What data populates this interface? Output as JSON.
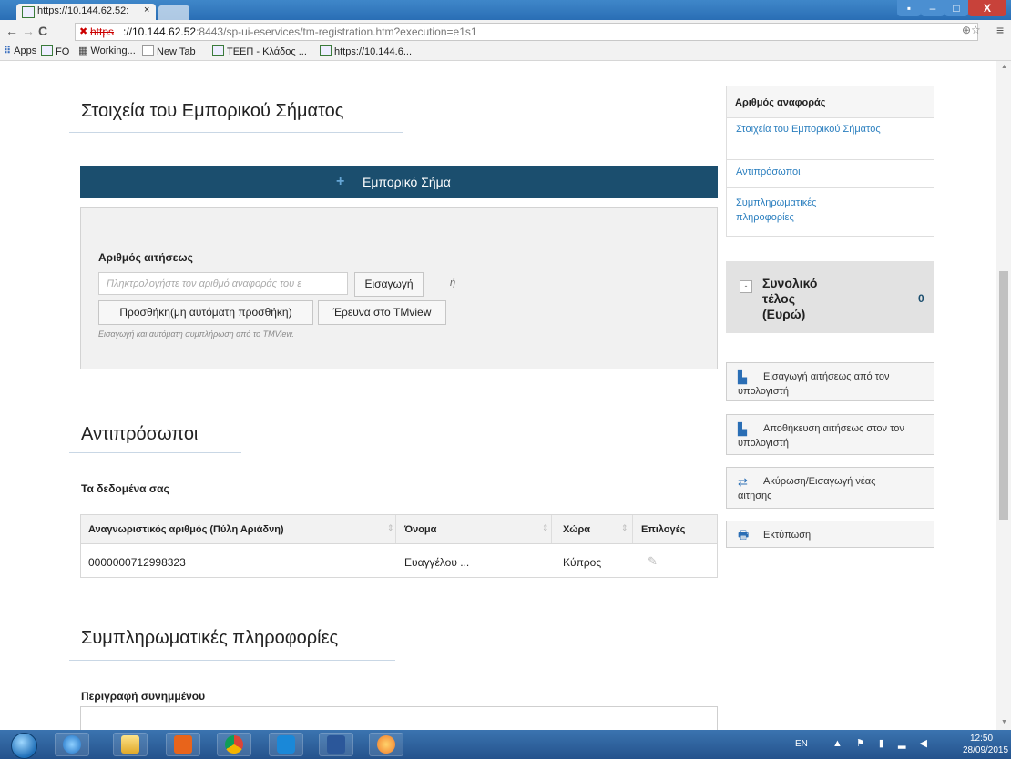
{
  "browser": {
    "tab_title": "https://10.144.62.52:",
    "tab_close": "×",
    "url_scheme": "https",
    "url_host": "://10.144.62.52",
    "url_rest": ":8443/sp-ui-eservices/tm-registration.htm?execution=e1s1",
    "nav": {
      "back": "←",
      "forward": "→",
      "reload": "C"
    },
    "zoom_star": "⊕☆",
    "menu": "≡",
    "window_buttons": {
      "min": "▪",
      "minimize": "–",
      "maximize": "□",
      "close": "X"
    }
  },
  "bookmarks": [
    {
      "label": "Apps",
      "icon": "apps-grid-icon"
    },
    {
      "label": "FO",
      "icon": "page-icon"
    },
    {
      "label": "Working...",
      "icon": "grid-icon"
    },
    {
      "label": "New Tab",
      "icon": "page-icon"
    },
    {
      "label": "ΤΕΕΠ - Κλάδος ...",
      "icon": "page-icon"
    },
    {
      "label": "https://10.144.6...",
      "icon": "page-icon"
    }
  ],
  "trademark_section": {
    "title": "Στοιχεία του Εμπορικού Σήματος",
    "bar_label": "Εμπορικό Σήμα",
    "bar_plus": "+",
    "application_number_label": "Αριθμός αιτήσεως",
    "application_number_placeholder": "Πληκτρολογήστε τον αριθμό αναφοράς του ε",
    "insert_button": "Εισαγωγή",
    "or_text": "ή",
    "add_button": "Προσθήκη(μη αυτόματη προσθήκη)",
    "tmview_button": "Έρευνα στο TMview",
    "hint": "Εισαγωγή και αυτόματη συμπλήρωση από το TMView."
  },
  "representatives_section": {
    "title": "Αντιπρόσωποι",
    "subtitle": "Τα δεδομένα σας",
    "columns": [
      "Αναγνωριστικός αριθμός (Πύλη Αριάδνη)",
      "Όνομα",
      "Χώρα",
      "Επιλογές"
    ],
    "rows": [
      {
        "id": "0000000712998323",
        "name": "Ευαγγέλου ...",
        "country": "Κύπρος"
      }
    ]
  },
  "supplementary_section": {
    "title": "Συμπληρωματικές πληροφορίες",
    "attachment_label": "Περιγραφή συνημμένου"
  },
  "sidebar": {
    "nav_header": "Αριθμός αναφοράς",
    "nav_items": [
      "Στοιχεία του Εμπορικού Σήματος",
      "Αντιπρόσωποι",
      "Συμπληρωματικές πληροφορίες"
    ],
    "fee_label": "Συνολικό τέλος (Ευρώ)",
    "fee_toggle": "-",
    "fee_value": "0",
    "actions": [
      {
        "label": "Εισαγωγή αιτήσεως από τον υπολογιστή",
        "icon": "file-import-icon"
      },
      {
        "label": "Αποθήκευση αιτήσεως στον τον υπολογιστή",
        "icon": "file-save-icon"
      },
      {
        "label": "Ακύρωση/Εισαγωγή νέας αιτησης",
        "icon": "refresh-icon"
      },
      {
        "label": "Εκτύπωση",
        "icon": "printer-icon"
      }
    ]
  },
  "taskbar": {
    "language": "EN",
    "tray": "▲ ⚑ ▮ ▂ ◀",
    "time": "12:50",
    "date": "28/09/2015"
  },
  "colors": {
    "primary_bar": "#1b4e6e",
    "link": "#2b7fbf",
    "taskbar": "#24528c"
  }
}
